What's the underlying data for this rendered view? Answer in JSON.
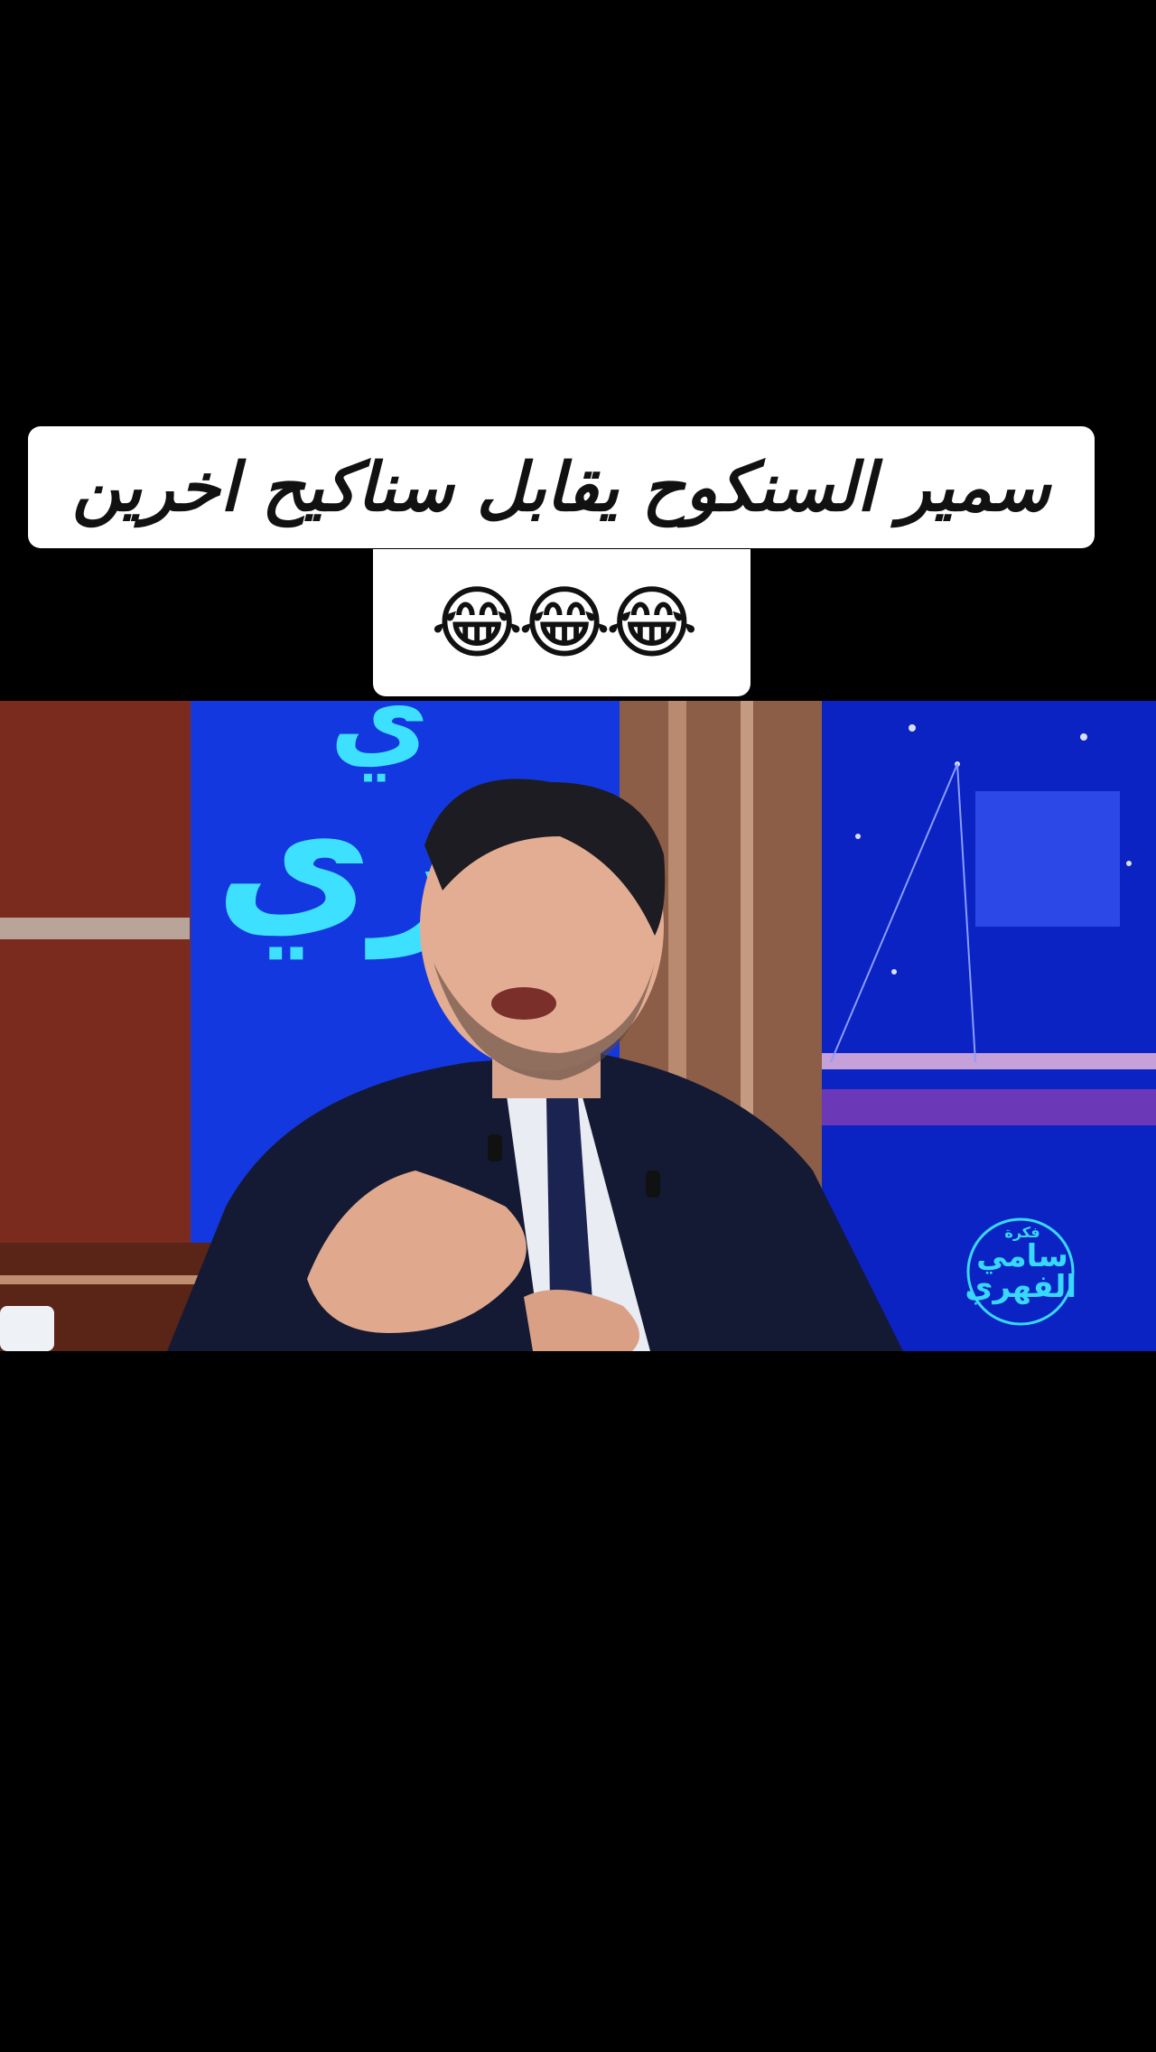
{
  "caption": {
    "line1": "سمير السنكوح يقابل سناكيح اخرين",
    "line2": "😂😂😂"
  },
  "video": {
    "watermark": {
      "top": "فكرة",
      "name_line1": "سامي",
      "name_line2": "الفهري"
    },
    "background_sign": "هري"
  }
}
